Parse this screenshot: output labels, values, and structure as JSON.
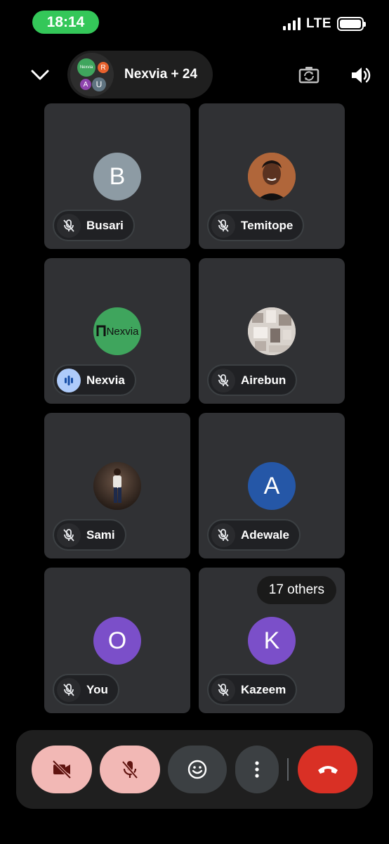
{
  "status_bar": {
    "time": "18:14",
    "network": "LTE",
    "time_color": "#34c759"
  },
  "header": {
    "title": "Nexvia + 24",
    "cluster": [
      {
        "text": "Nexvia",
        "color": "#3fa55d"
      },
      {
        "text": "R",
        "color": "#e8612c"
      },
      {
        "text": "A",
        "color": "#8e44ad"
      },
      {
        "text": "U",
        "color": "#5f7380"
      }
    ],
    "icons": [
      "chevron-down-icon",
      "flip-camera-icon",
      "speaker-icon"
    ]
  },
  "participants": [
    {
      "name": "Busari",
      "initial": "B",
      "avatar_color": "#8d9ba4",
      "mic": "muted"
    },
    {
      "name": "Temitope",
      "initial": "",
      "avatar_type": "photo",
      "mic": "muted"
    },
    {
      "name": "Nexvia",
      "initial": "",
      "avatar_type": "logo",
      "logo_text": "Nexvia",
      "avatar_color": "#3fa55d",
      "mic": "speaking"
    },
    {
      "name": "Airebun",
      "initial": "",
      "avatar_type": "photo",
      "mic": "muted"
    },
    {
      "name": "Sami",
      "initial": "",
      "avatar_type": "photo",
      "mic": "muted"
    },
    {
      "name": "Adewale",
      "initial": "A",
      "avatar_color": "#2557a7",
      "mic": "muted"
    },
    {
      "name": "You",
      "initial": "O",
      "avatar_color": "#7b4fc9",
      "mic": "muted"
    },
    {
      "name": "Kazeem",
      "initial": "K",
      "avatar_color": "#7b4fc9",
      "mic": "muted",
      "badge": "17 others"
    }
  ],
  "controls": [
    {
      "name": "camera-off-button",
      "icon": "camera-off-icon",
      "color": "#f2b8b5"
    },
    {
      "name": "mic-off-button",
      "icon": "mic-off-icon",
      "color": "#f2b8b5"
    },
    {
      "name": "reactions-button",
      "icon": "emoji-icon",
      "color": "#3c4043"
    },
    {
      "name": "more-options-button",
      "icon": "more-vertical-icon",
      "color": "#3c4043"
    },
    {
      "name": "end-call-button",
      "icon": "hang-up-icon",
      "color": "#d93025"
    }
  ]
}
